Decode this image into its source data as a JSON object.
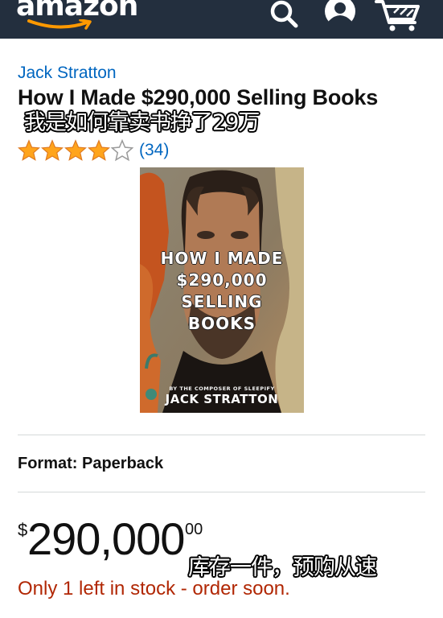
{
  "header": {
    "logo_text": "amazon",
    "icons": [
      "search-icon",
      "account-icon",
      "cart-icon"
    ],
    "background_color": "#232f3e",
    "smile_color": "#ff9900"
  },
  "product": {
    "author": "Jack Stratton",
    "title": "How I Made $290,000 Selling Books",
    "subtitle_overlay": "我是如何靠卖书挣了29万",
    "rating": 4,
    "rating_max": 5,
    "review_count": "(34)",
    "cover": {
      "title_lines": [
        "HOW I MADE",
        "$290,000",
        "SELLING",
        "BOOKS"
      ],
      "byline": "BY THE COMPOSER OF SLEEPIFY",
      "author": "JACK STRATTON"
    },
    "format": "Format: Paperback",
    "price": {
      "currency_symbol": "$",
      "whole": "290,000",
      "fraction": "00"
    },
    "stock_text": "Only 1 left in stock - order soon.",
    "stock_overlay": "库存一件，预购从速"
  },
  "colors": {
    "link": "#0066c0",
    "price_alert": "#b12704",
    "star": "#ffa41c"
  }
}
